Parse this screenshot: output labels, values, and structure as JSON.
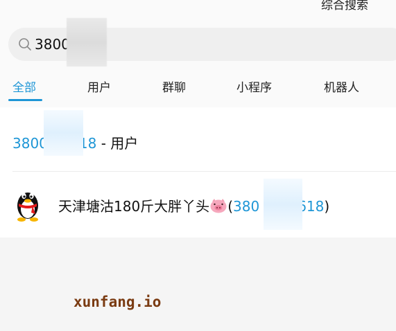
{
  "header": {
    "title": "综合搜索"
  },
  "search": {
    "query": "380018"
  },
  "tabs": [
    {
      "label": "全部",
      "active": true
    },
    {
      "label": "用户"
    },
    {
      "label": "群聊"
    },
    {
      "label": "小程序"
    },
    {
      "label": "机器人"
    }
  ],
  "results": {
    "suggestion": {
      "number_prefix": "3800",
      "number_suffix": "18",
      "label": " - 用户"
    },
    "contact": {
      "name": "天津塘沽180斤大胖丫头",
      "open_paren": "(",
      "qq_prefix": "380",
      "qq_suffix": "618",
      "close_paren": ")"
    }
  },
  "watermark": "xunfang.io",
  "colors": {
    "accent": "#1e96d6",
    "background": "#f5f5f5"
  }
}
